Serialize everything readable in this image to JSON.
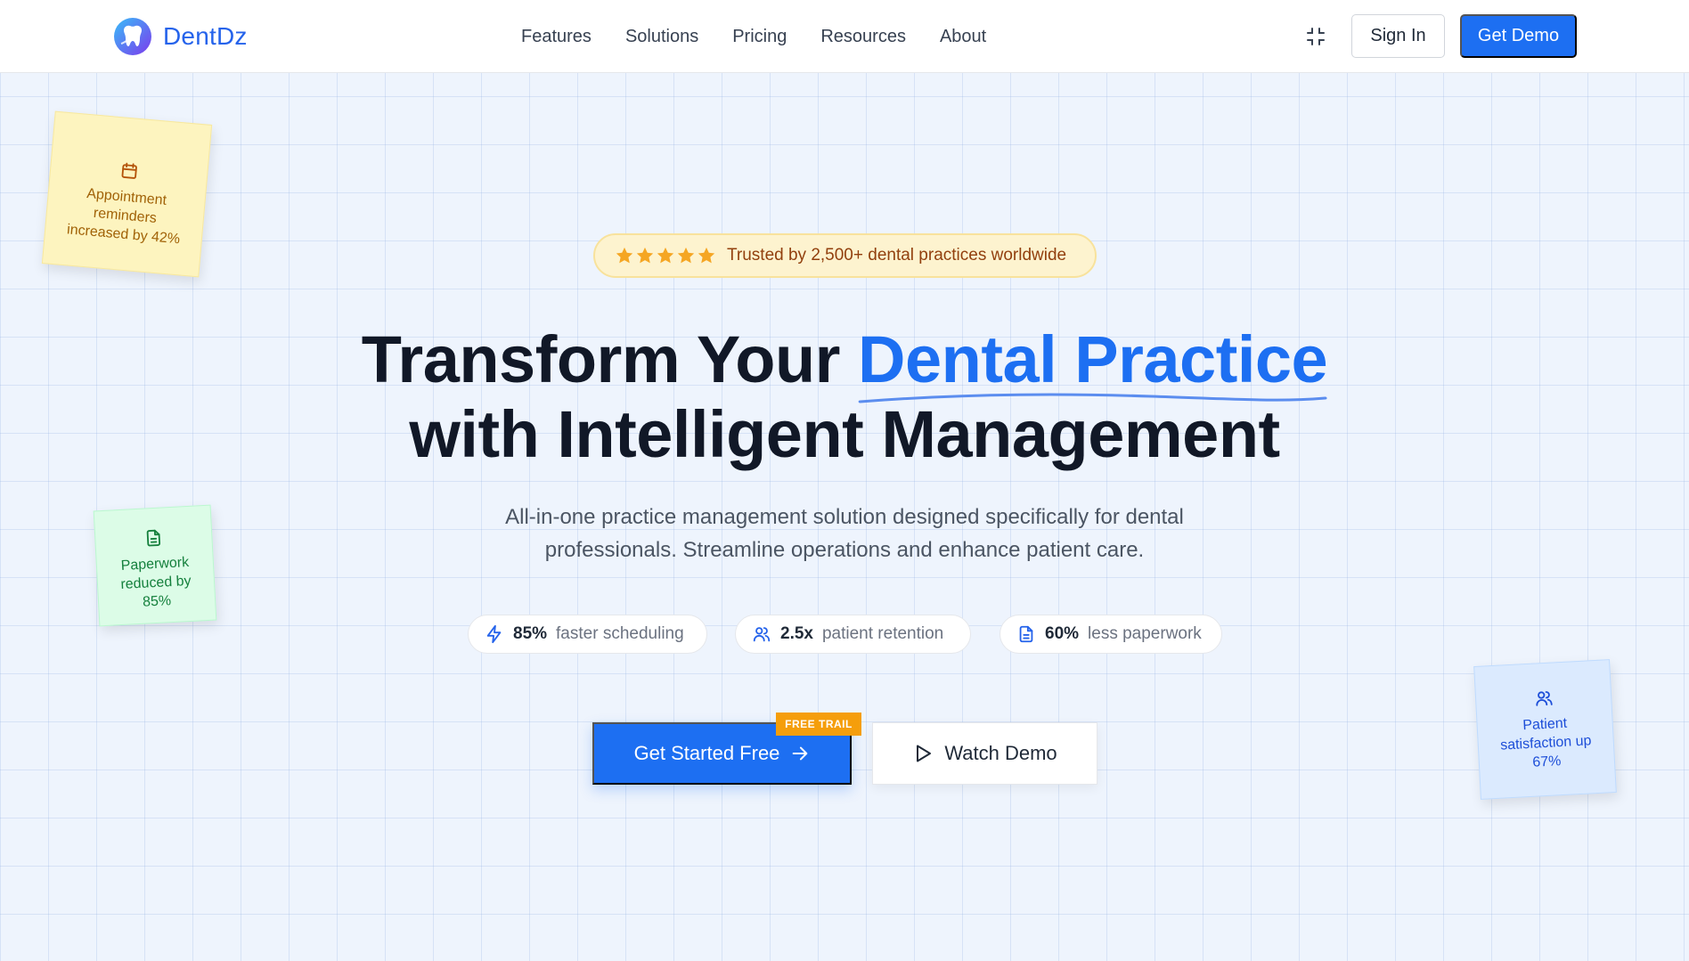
{
  "brand": {
    "name": "DentDz",
    "logo_icon": "tooth-logo-icon"
  },
  "nav": {
    "items": [
      "Features",
      "Solutions",
      "Pricing",
      "Resources",
      "About"
    ],
    "collapse_icon": "minimize-icon",
    "sign_in": "Sign In",
    "get_demo": "Get Demo"
  },
  "notes": {
    "yellow": {
      "icon": "calendar-icon",
      "text": "Appointment reminders increased by 42%"
    },
    "green": {
      "icon": "document-icon",
      "text": "Paperwork reduced by 85%"
    },
    "blue": {
      "icon": "users-icon",
      "text": "Patient satisfaction up 67%"
    }
  },
  "trust": {
    "stars": 5,
    "text": "Trusted by 2,500+ dental practices worldwide"
  },
  "hero": {
    "title_start": "Transform Your",
    "title_accent": "Dental Practice",
    "title_end": "with Intelligent Management",
    "subtitle": "All-in-one practice management solution designed specifically for dental professionals. Streamline operations and enhance patient care."
  },
  "stats": [
    {
      "icon": "lightning-icon",
      "value": "85%",
      "label": "faster scheduling"
    },
    {
      "icon": "users-icon",
      "value": "2.5x",
      "label": "patient retention"
    },
    {
      "icon": "document-icon",
      "value": "60%",
      "label": "less paperwork"
    }
  ],
  "cta": {
    "primary": "Get Started Free",
    "badge": "FREE TRAIL",
    "secondary": "Watch Demo"
  },
  "colors": {
    "accent": "#1d6ff2",
    "star": "#f5a623",
    "badge": "#f59e0b"
  }
}
